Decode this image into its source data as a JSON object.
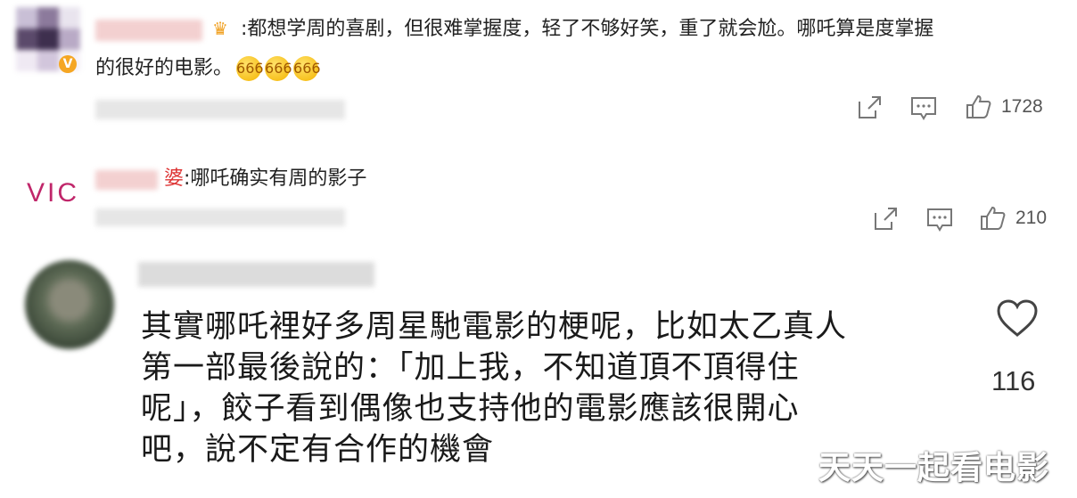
{
  "comments": [
    {
      "text_line1": ":都想学周的喜剧，但很难掌握度，轻了不够好笑，重了就会尬。哪吒算是度掌握",
      "text_line2": "的很好的电影。",
      "emojis": [
        "666",
        "666",
        "666"
      ],
      "actions": {
        "share_icon": "share-icon",
        "reply_icon": "comment-icon",
        "like_icon": "thumb-up-icon",
        "likes": "1728"
      }
    },
    {
      "name_suffix": "婆",
      "text": ":哪吒确实有周的影子",
      "avatar_text": "VIC",
      "actions": {
        "share_icon": "share-icon",
        "reply_icon": "comment-icon",
        "like_icon": "thumb-up-icon",
        "likes": "210"
      }
    },
    {
      "text_lines": [
        "其實哪吒裡好多周星馳電影的梗呢，比如太乙真人",
        "第一部最後說的：「加上我，不知道頂不頂得住",
        "呢」，餃子看到偶像也支持他的電影應該很開心",
        "吧，說不定有合作的機會"
      ],
      "like_icon": "heart-icon",
      "likes": "116"
    }
  ],
  "watermark": "天天一起看电影"
}
